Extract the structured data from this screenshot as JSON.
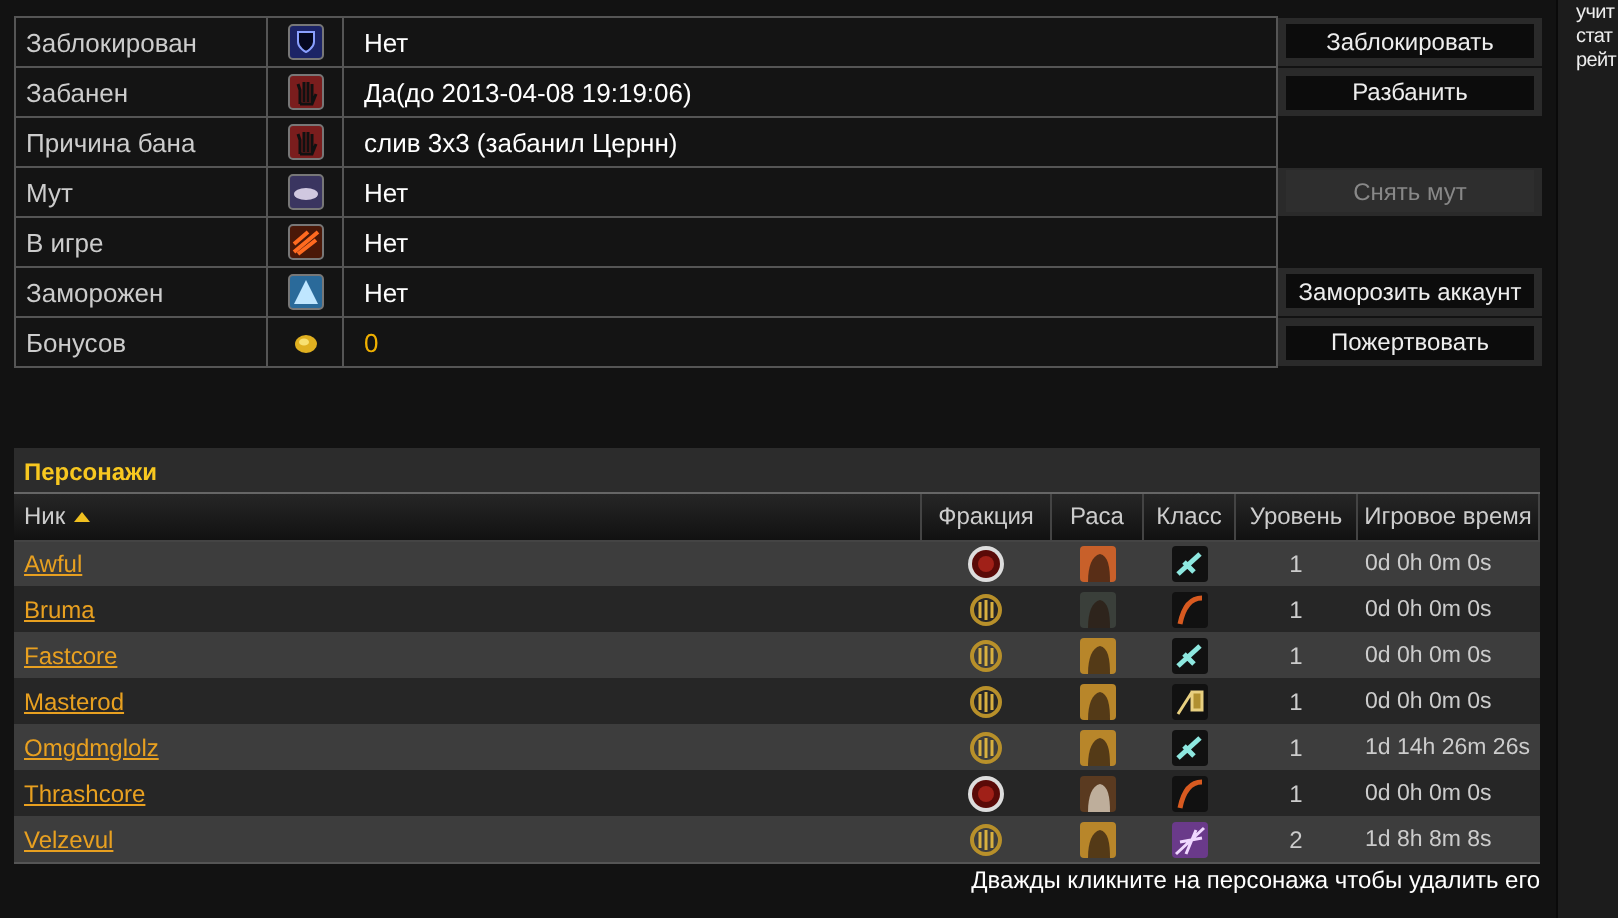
{
  "account_rows": [
    {
      "label": "Заблокирован",
      "kind": "shield",
      "value": "Нет",
      "highlight": false,
      "button": {
        "label": "Заблокировать",
        "disabled": false
      }
    },
    {
      "label": "Забанен",
      "kind": "hand",
      "value": "Да(до 2013-04-08 19:19:06)",
      "highlight": false,
      "button": {
        "label": "Разбанить",
        "disabled": false
      }
    },
    {
      "label": "Причина бана",
      "kind": "hand",
      "value": "слив 3х3 (забанил Цернн)",
      "highlight": false
    },
    {
      "label": "Мут",
      "kind": "scroll",
      "value": "Нет",
      "highlight": false,
      "button": {
        "label": "Снять мут",
        "disabled": true
      }
    },
    {
      "label": "В игре",
      "kind": "fire",
      "value": "Нет",
      "highlight": false
    },
    {
      "label": "Заморожен",
      "kind": "frost",
      "value": "Нет",
      "highlight": false,
      "button": {
        "label": "Заморозить аккаунт",
        "disabled": false
      }
    },
    {
      "label": "Бонусов",
      "kind": "coin",
      "value": "0",
      "highlight": true,
      "button": {
        "label": "Пожертвовать",
        "disabled": false
      }
    }
  ],
  "characters": {
    "title": "Персонажи",
    "columns": [
      {
        "label": "Ник",
        "sorted": true
      },
      {
        "label": "Фракция",
        "sorted": false
      },
      {
        "label": "Раса",
        "sorted": false
      },
      {
        "label": "Класс",
        "sorted": false
      },
      {
        "label": "Уровень",
        "sorted": false
      },
      {
        "label": "Игровое время",
        "sorted": false
      }
    ],
    "rows": [
      {
        "name": "Awful",
        "faction": {
          "kind": "horde"
        },
        "race": {
          "kind": "fiery"
        },
        "class": {
          "kind": "gun"
        },
        "level": "1",
        "time": "0d 0h 0m 0s"
      },
      {
        "name": "Bruma",
        "faction": {
          "kind": "alliance"
        },
        "race": {
          "kind": "hooded"
        },
        "class": {
          "kind": "bow"
        },
        "level": "1",
        "time": "0d 0h 0m 0s"
      },
      {
        "name": "Fastcore",
        "faction": {
          "kind": "alliance"
        },
        "race": {
          "kind": "blonde"
        },
        "class": {
          "kind": "gun"
        },
        "level": "1",
        "time": "0d 0h 0m 0s"
      },
      {
        "name": "Masterod",
        "faction": {
          "kind": "alliance"
        },
        "race": {
          "kind": "blonde"
        },
        "class": {
          "kind": "card"
        },
        "level": "1",
        "time": "0d 0h 0m 0s"
      },
      {
        "name": "Omgdmglolz",
        "faction": {
          "kind": "alliance"
        },
        "race": {
          "kind": "blonde"
        },
        "class": {
          "kind": "gun"
        },
        "level": "1",
        "time": "1d 14h 26m 26s"
      },
      {
        "name": "Thrashcore",
        "faction": {
          "kind": "horde"
        },
        "race": {
          "kind": "beast"
        },
        "class": {
          "kind": "bow"
        },
        "level": "1",
        "time": "0d 0h 0m 0s"
      },
      {
        "name": "Velzevul",
        "faction": {
          "kind": "alliance"
        },
        "race": {
          "kind": "blonde"
        },
        "class": {
          "kind": "claw"
        },
        "level": "2",
        "time": "1d 8h 8m 8s"
      }
    ],
    "hint": "Дважды кликните на персонажа чтобы удалить его"
  },
  "sidebar": {
    "lines": [
      "учит",
      "стат",
      "рейт"
    ]
  }
}
